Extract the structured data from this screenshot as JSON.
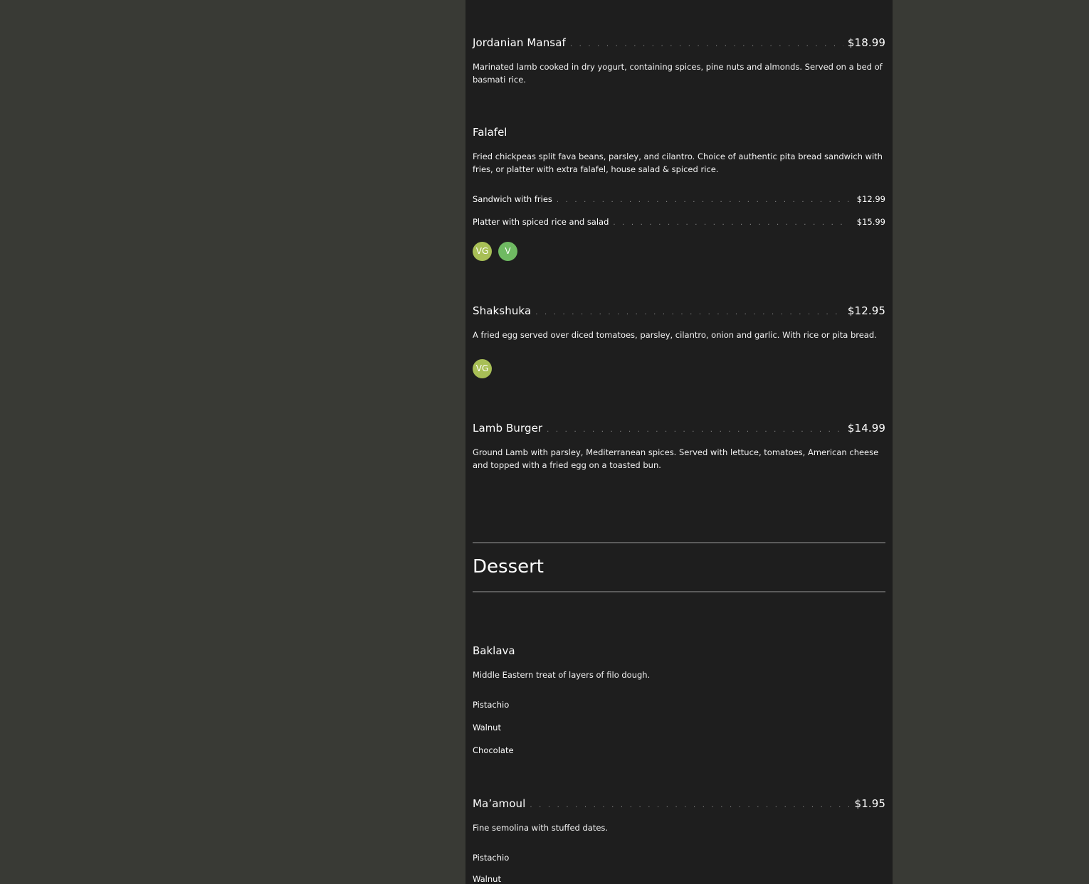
{
  "colors": {
    "page_background": "#393a35",
    "panel_background": "#1e1e1e",
    "text": "#ffffff",
    "vegan_badge": "#a8bf56",
    "vegetarian_badge": "#6fba62",
    "divider": "#5b5b5b"
  },
  "items": {
    "mansaf": {
      "name": "Jordanian Mansaf",
      "price": "$18.99",
      "description": "Marinated lamb cooked in dry yogurt, containing spices, pine nuts and almonds. Served on a bed of basmati rice."
    },
    "falafel": {
      "name": "Falafel",
      "description": "Fried chickpeas split fava beans, parsley, and cilantro. Choice of authentic pita bread sandwich with fries, or platter with extra falafel, house salad & spiced rice.",
      "options": [
        {
          "label": "Sandwich with fries",
          "price": "$12.99"
        },
        {
          "label": "Platter with spiced rice and salad",
          "price": "$15.99"
        }
      ],
      "badges": [
        "VG",
        "V"
      ]
    },
    "shakshuka": {
      "name": "Shakshuka",
      "price": "$12.95",
      "description": "A fried egg served over diced tomatoes, parsley, cilantro, onion and garlic. With rice or pita bread.",
      "badges": [
        "VG"
      ]
    },
    "lamb_burger": {
      "name": "Lamb Burger",
      "price": "$14.99",
      "description": "Ground Lamb with parsley, Mediterranean spices. Served with lettuce, tomatoes, American cheese and topped with a fried egg on a toasted bun."
    }
  },
  "dessert": {
    "section_title": "Dessert",
    "baklava": {
      "name": "Baklava",
      "description": "Middle Eastern treat of layers of filo dough.",
      "options": [
        "Pistachio",
        "Walnut",
        "Chocolate"
      ]
    },
    "maamoul": {
      "name": "Ma’amoul",
      "price": "$1.95",
      "description": "Fine semolina with stuffed dates.",
      "options": [
        "Pistachio",
        "Walnut"
      ]
    }
  }
}
